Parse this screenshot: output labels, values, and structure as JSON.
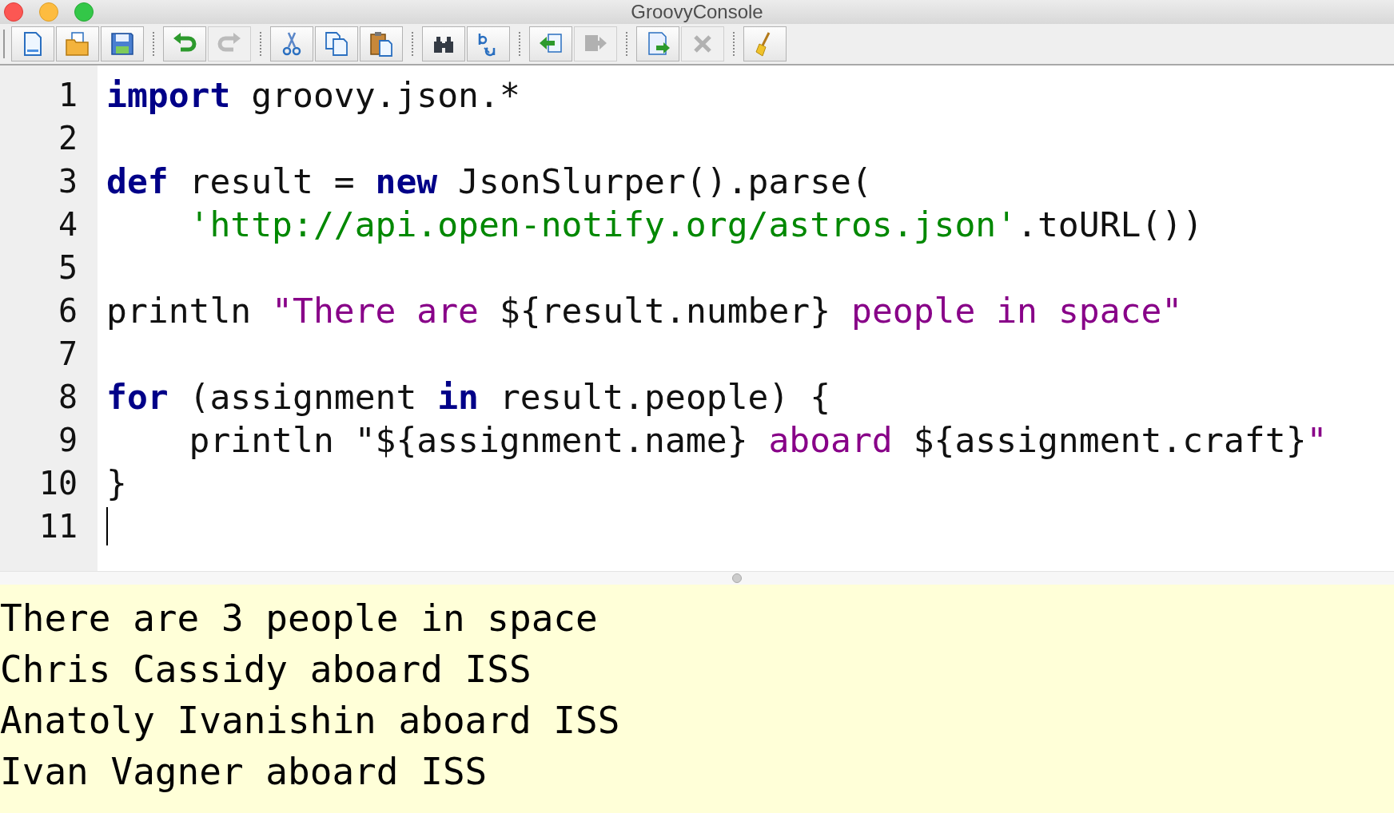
{
  "window": {
    "title": "GroovyConsole"
  },
  "toolbar": [
    {
      "kind": "new",
      "disabled": false
    },
    {
      "kind": "open",
      "disabled": false
    },
    {
      "kind": "save",
      "disabled": false
    },
    {
      "kind": "separator"
    },
    {
      "kind": "undo",
      "disabled": false
    },
    {
      "kind": "redo",
      "disabled": true
    },
    {
      "kind": "separator"
    },
    {
      "kind": "cut",
      "disabled": false
    },
    {
      "kind": "copy",
      "disabled": false
    },
    {
      "kind": "paste",
      "disabled": false
    },
    {
      "kind": "separator"
    },
    {
      "kind": "find",
      "disabled": false
    },
    {
      "kind": "replace",
      "disabled": false
    },
    {
      "kind": "separator"
    },
    {
      "kind": "history-back",
      "disabled": false
    },
    {
      "kind": "history-forward",
      "disabled": true
    },
    {
      "kind": "separator"
    },
    {
      "kind": "run",
      "disabled": false
    },
    {
      "kind": "interrupt",
      "disabled": true
    },
    {
      "kind": "separator"
    },
    {
      "kind": "clear",
      "disabled": false
    }
  ],
  "editor": {
    "lines": [
      {
        "number": "1",
        "tokens": [
          {
            "kind": "keyword",
            "text": "import"
          },
          {
            "kind": "plain",
            "text": " groovy.json.*"
          }
        ]
      },
      {
        "number": "2"
      },
      {
        "number": "3",
        "tokens": [
          {
            "kind": "keyword",
            "text": "def"
          },
          {
            "kind": "plain",
            "text": " result = "
          },
          {
            "kind": "keyword",
            "text": "new"
          },
          {
            "kind": "plain",
            "text": " JsonSlurper().parse("
          }
        ]
      },
      {
        "number": "4",
        "indented": true,
        "tokens": [
          {
            "kind": "string",
            "text": "'http://api.open-notify.org/astros.json'"
          },
          {
            "kind": "plain",
            "text": ".toURL())"
          }
        ]
      },
      {
        "number": "5"
      },
      {
        "number": "6",
        "tokens": [
          {
            "kind": "plain",
            "text": "println "
          },
          {
            "kind": "gstring",
            "text": "\"There are "
          },
          {
            "kind": "plain",
            "text": "${result.number}"
          },
          {
            "kind": "gstring",
            "text": " people in space\""
          }
        ]
      },
      {
        "number": "7"
      },
      {
        "number": "8",
        "tokens": [
          {
            "kind": "keyword",
            "text": "for"
          },
          {
            "kind": "plain",
            "text": " (assignment "
          },
          {
            "kind": "keyword",
            "text": "in"
          },
          {
            "kind": "plain",
            "text": " result.people) {"
          }
        ]
      },
      {
        "number": "9",
        "indented": true,
        "tokens": [
          {
            "kind": "plain",
            "text": "println \"${assignment.name}"
          },
          {
            "kind": "gstring",
            "text": " aboard "
          },
          {
            "kind": "plain",
            "text": "${assignment.craft}"
          },
          {
            "kind": "gstring",
            "text": "\""
          }
        ]
      },
      {
        "number": "10",
        "tokens": [
          {
            "kind": "plain",
            "text": "}"
          }
        ]
      },
      {
        "number": "11",
        "cursor": true
      }
    ]
  },
  "output": [
    "There are 3 people in space",
    "Chris Cassidy aboard ISS",
    "Anatoly Ivanishin aboard ISS",
    "Ivan Vagner aboard ISS"
  ]
}
